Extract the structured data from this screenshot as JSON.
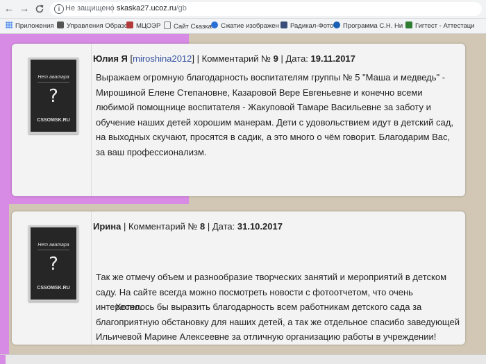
{
  "browser": {
    "back_icon": "←",
    "forward_icon": "→",
    "reload_icon": "C",
    "security_text": "Не защищено",
    "url_host": "skaska27.ucoz.ru",
    "url_path": "/gb"
  },
  "bookmarks": [
    {
      "label": "Приложения",
      "color": "#4285f4"
    },
    {
      "label": "Управления Образо",
      "color": "#555555"
    },
    {
      "label": "МЦОЭР",
      "color": "#b33a3a"
    },
    {
      "label": "Сайт Сказка",
      "color": "#777777"
    },
    {
      "label": "Сжатие изображен",
      "color": "#2a6fd6"
    },
    {
      "label": "Радикал-Фото",
      "color": "#3a4d7a"
    },
    {
      "label": "Программа С.Н. Ни",
      "color": "#1a5fb4"
    },
    {
      "label": "Гигтест - Аттестаци",
      "color": "#2e7d32"
    }
  ],
  "avatar": {
    "no_avatar": "Нет аватара",
    "question": "?",
    "site": "CSSOMSK.RU"
  },
  "comments": [
    {
      "author": "Юлия Я",
      "login_open": " [",
      "login": "miroshina2012",
      "login_close": "]",
      "comment_label": " | Комментарий № ",
      "number": "9",
      "date_label": " | Дата: ",
      "date": "19.11.2017",
      "text": "Выражаем огромную благодарность воспитателям группы № 5 \"Маша и медведь\" - Мирошиной Елене Степановне, Казаровой Вере Евгеньевне и конечно всеми любимой помощнице воспитателя - Жакуповой Тамаре Васильевне за заботу и обучение наших детей хорошим манерам. Дети с удовольствием идут в детский сад, на выходных скучают, просятся в садик, а это много о чём говорит. Благодарим Вас, за ваш профессионализм."
    },
    {
      "author": "Ирина",
      "comment_label": " | Комментарий № ",
      "number": "8",
      "date_label": " | Дата: ",
      "date": "31.10.2017",
      "text_p1": "Так же отмечу объем и разнообразие творческих занятий и мероприятий в детском саду. На сайте всегда можно посмотреть новости с фотоотчетом, что очень интересно.",
      "text_p2": "Хотелось бы выразить благодарность всем работникам детского сада за благоприятную обстановку для наших детей, а так же отдельное спасибо заведующей Ильичевой Марине Алексеевне за отличную организацию работы в учреждении!"
    }
  ]
}
